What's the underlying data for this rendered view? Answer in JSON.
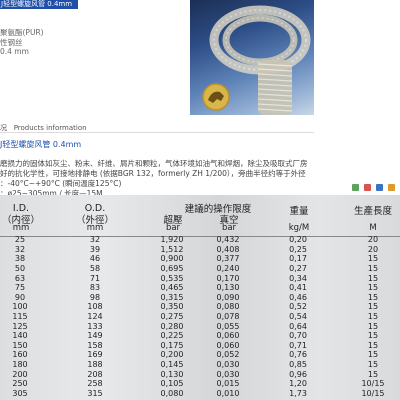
{
  "title": "J轻型螺旋风管 0.4mm",
  "specs": [
    "聚氨酯(PUR)",
    "性钢丝",
    "0.4 mm"
  ],
  "section": {
    "label": "况",
    "label_en": "Products information"
  },
  "product_link": "J轻型螺旋风管 0.4mm",
  "description": [
    "磨损力的固体如灰尘、粉末、纤维、屑片和颗粒，气体环境如油气和焊烟，除尘及吸取式厂房",
    "好的抗化学性，可接地排静电 (依据BGR 132，formerly ZH 1/200），旁曲半径约等于外径",
    "：-40°C~+90°C (瞬间温度125°C)",
    "：ø25~305mm / 长度—15M"
  ],
  "share_icons": [
    {
      "name": "share-green-icon",
      "color": "#5aa55a"
    },
    {
      "name": "share-red-icon",
      "color": "#d9534f"
    },
    {
      "name": "share-blue-icon",
      "color": "#3b73c4"
    },
    {
      "name": "share-orange-icon",
      "color": "#e09a2a"
    },
    {
      "name": "share-teal-icon",
      "color": "#3aa7a7"
    }
  ],
  "table": {
    "headers": {
      "id": "I.D.",
      "id_sub": "（内徑）",
      "id_unit": "mm",
      "od": "O.D.",
      "od_sub": "（外徑）",
      "od_unit": "mm",
      "pressure_title": "建議的操作限度",
      "over": "超壓",
      "over_unit": "bar",
      "vac": "真空",
      "vac_unit": "bar",
      "weight": "重量",
      "weight_unit": "kg/M",
      "length": "生產長度",
      "length_unit": "M"
    },
    "rows": [
      [
        "25",
        "32",
        "1,920",
        "0,432",
        "0,20",
        "20"
      ],
      [
        "32",
        "39",
        "1,512",
        "0,408",
        "0,25",
        "20"
      ],
      [
        "38",
        "46",
        "0,900",
        "0,377",
        "0,17",
        "15"
      ],
      [
        "50",
        "58",
        "0,695",
        "0,240",
        "0,27",
        "15"
      ],
      [
        "63",
        "71",
        "0,535",
        "0,170",
        "0,34",
        "15"
      ],
      [
        "75",
        "83",
        "0,465",
        "0,130",
        "0,41",
        "15"
      ],
      [
        "90",
        "98",
        "0,315",
        "0,090",
        "0,46",
        "15"
      ],
      [
        "100",
        "108",
        "0,350",
        "0,080",
        "0,52",
        "15"
      ],
      [
        "115",
        "124",
        "0,275",
        "0,078",
        "0,54",
        "15"
      ],
      [
        "125",
        "133",
        "0,280",
        "0,055",
        "0,64",
        "15"
      ],
      [
        "140",
        "149",
        "0,225",
        "0,060",
        "0,70",
        "15"
      ],
      [
        "150",
        "158",
        "0,175",
        "0,060",
        "0,71",
        "15"
      ],
      [
        "160",
        "169",
        "0,200",
        "0,052",
        "0,76",
        "15"
      ],
      [
        "180",
        "188",
        "0,145",
        "0,030",
        "0,85",
        "15"
      ],
      [
        "200",
        "208",
        "0,130",
        "0,030",
        "0,96",
        "15"
      ],
      [
        "250",
        "258",
        "0,105",
        "0,015",
        "1,20",
        "10/15"
      ],
      [
        "305",
        "315",
        "0,080",
        "0,010",
        "1,73",
        "10/15"
      ]
    ]
  }
}
